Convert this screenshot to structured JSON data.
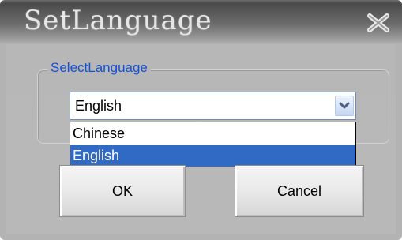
{
  "window": {
    "title": "SetLanguage",
    "close_icon": "close-icon"
  },
  "group": {
    "label": "SelectLanguage"
  },
  "language_select": {
    "value": "English",
    "options": [
      "Chinese",
      "English"
    ],
    "highlighted": "English",
    "arrow_icon": "chevron-down-icon"
  },
  "buttons": {
    "ok_label": "OK",
    "cancel_label": "Cancel"
  },
  "colors": {
    "group_label": "#1450d6",
    "selection": "#316ac5"
  }
}
